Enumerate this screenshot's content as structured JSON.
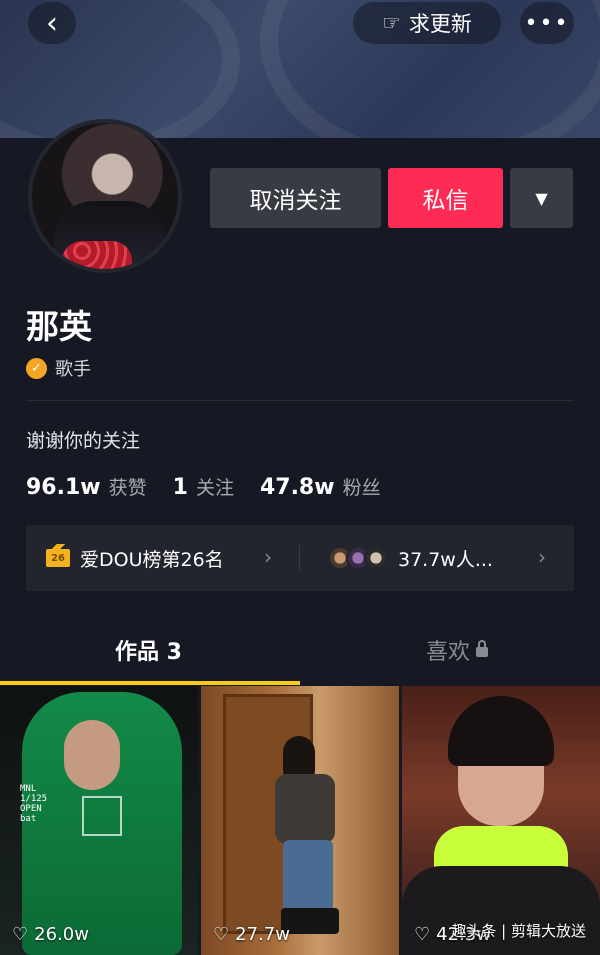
{
  "header": {
    "back_icon": "‹",
    "update_icon": "☞",
    "update_label": "求更新",
    "more_icon": "•••"
  },
  "profile": {
    "unfollow_label": "取消关注",
    "message_label": "私信",
    "dropdown_icon": "▼",
    "name": "那英",
    "verified_icon": "✓",
    "tag": "歌手",
    "bio": "谢谢你的关注",
    "stats": {
      "likes_value": "96.1w",
      "likes_label": "获赞",
      "following_value": "1",
      "following_label": "关注",
      "fans_value": "47.8w",
      "fans_label": "粉丝"
    }
  },
  "rank": {
    "crown_number": "26",
    "rank_label": "爱DOU榜第26名",
    "fans_text": "37.7w人...",
    "chevron_icon": "›"
  },
  "tabs": {
    "works_label": "作品 3",
    "likes_label": "喜欢"
  },
  "videos": [
    {
      "likes": "26.0w",
      "camera_tag": "MNL\n1/125\nOPEN\nbat"
    },
    {
      "likes": "27.7w"
    },
    {
      "likes": "42.3w",
      "watermark": "趣头条 | 剪辑大放送"
    }
  ],
  "colors": {
    "background": "#161823",
    "primary_button": "#fe2c55",
    "secondary_button": "#393b44",
    "tab_indicator": "#facc15",
    "verified_badge": "#f5a623"
  }
}
